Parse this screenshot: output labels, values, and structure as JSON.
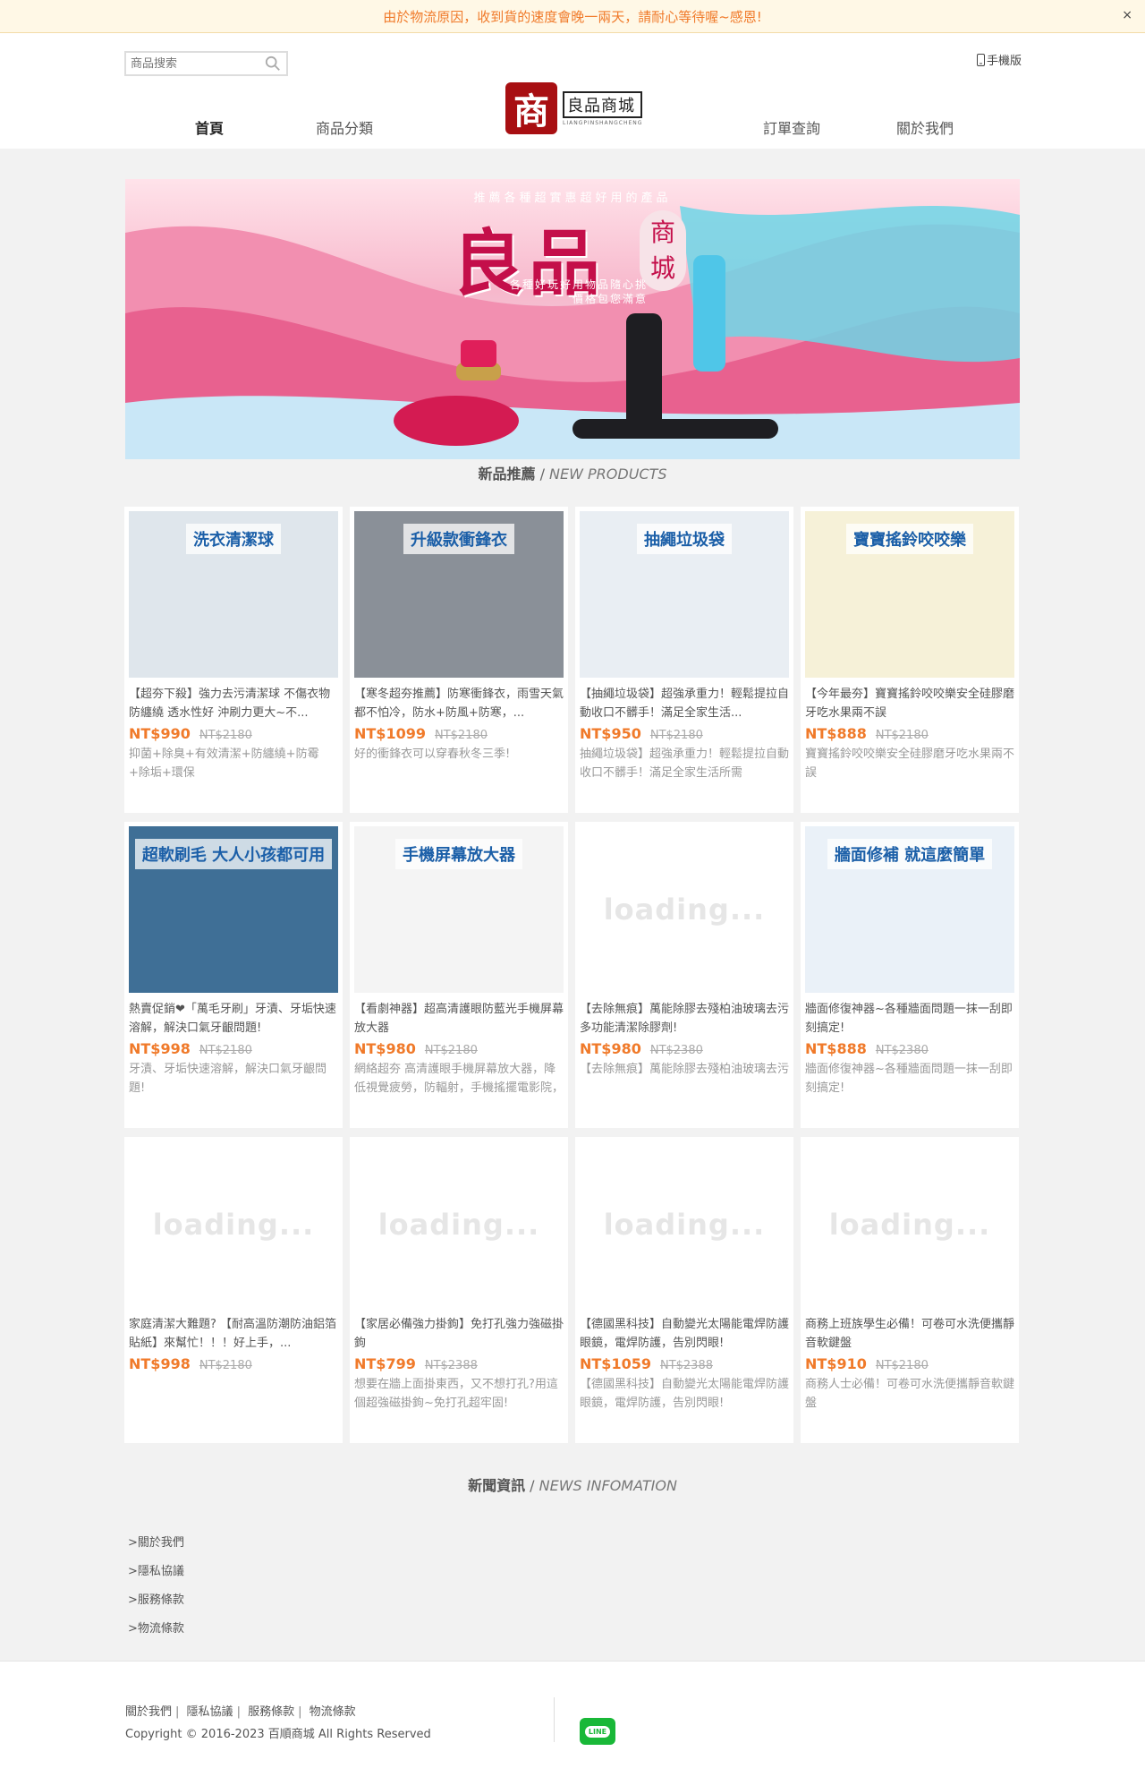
{
  "notice": {
    "text": "由於物流原因，收到貨的速度會晚一兩天，請耐心等待喔~感恩!",
    "close": "×"
  },
  "header": {
    "search_placeholder": "商品搜索",
    "mobile_label": "手機版",
    "nav": [
      "首頁",
      "商品分類",
      "訂單查詢",
      "關於我們"
    ],
    "logo_mark": "商",
    "logo_text": "良品商城",
    "logo_sub": "LIANGPINSHANGCHENG"
  },
  "banner": {
    "tagline": "推薦各種超實惠超好用的產品",
    "headline": "良品",
    "seal": [
      "商",
      "城"
    ],
    "sub_lines": [
      "各種好玩好用物品隨心挑",
      "價格包您滿意"
    ]
  },
  "sections": {
    "new_products": {
      "cn": "新品推薦",
      "sep": " / ",
      "en": "NEW PRODUCTS"
    },
    "news": {
      "cn": "新聞資訊",
      "sep": " / ",
      "en": "NEWS INFOMATION"
    }
  },
  "products": [
    {
      "image_text": "洗衣清潔球",
      "title": "【超夯下殺】強力去污清潔球 不傷衣物 防纏繞 透水性好 沖刷力更大~不...",
      "price": "NT$990",
      "old_price": "NT$2180",
      "desc": "抑菌+除臭+有效清潔+防纏繞+防霉+除垢+環保",
      "loading": false,
      "bg": "#dfe6ec"
    },
    {
      "image_text": "升級款衝鋒衣",
      "title": "【寒冬超夯推薦】防寒衝鋒衣，雨雪天氣都不怕冷，防水+防風+防寒，...",
      "price": "NT$1099",
      "old_price": "NT$2180",
      "desc": "好的衝鋒衣可以穿春秋冬三季!",
      "loading": false,
      "bg": "#8a9098"
    },
    {
      "image_text": "抽繩垃圾袋",
      "title": "【抽繩垃圾袋】超強承重力！輕鬆提拉自動收口不髒手！滿足全家生活...",
      "price": "NT$950",
      "old_price": "NT$2180",
      "desc": "抽繩垃圾袋】超強承重力！輕鬆提拉自動收口不髒手！滿足全家生活所需",
      "loading": false,
      "bg": "#e9eef3"
    },
    {
      "image_text": "寶寶搖鈴咬咬樂",
      "title": "【今年最夯】寶寶搖鈴咬咬樂安全硅膠磨牙吃水果兩不誤",
      "price": "NT$888",
      "old_price": "NT$2180",
      "desc": "寶寶搖鈴咬咬樂安全硅膠磨牙吃水果兩不誤",
      "loading": false,
      "bg": "#f6f1d8"
    },
    {
      "image_text": "超軟刷毛 大人小孩都可用",
      "title": "熱賣促銷❤「萬毛牙刷」牙漬、牙垢快速溶解，解決口氣牙齦問題!",
      "price": "NT$998",
      "old_price": "NT$2180",
      "desc": "牙漬、牙垢快速溶解，解決口氣牙齦問題!",
      "loading": false,
      "bg": "#3f6f96"
    },
    {
      "image_text": "手機屏幕放大器",
      "title": "【看劇神器】超高清護眼防藍光手機屏幕放大器",
      "price": "NT$980",
      "old_price": "NT$2180",
      "desc": "網絡超夯 高清護眼手機屏幕放大器，降低視覺疲勞，防輻射，手機搖擺電影院，輕鬆享受視覺盛宴",
      "loading": false,
      "bg": "#f4f4f4"
    },
    {
      "image_text": "loading...",
      "title": "【去除無痕】萬能除膠去殘柏油玻璃去污多功能清潔除膠劑!",
      "price": "NT$980",
      "old_price": "NT$2380",
      "desc": "【去除無痕】萬能除膠去殘柏油玻璃去污",
      "loading": true,
      "bg": "#ffffff"
    },
    {
      "image_text": "牆面修補 就這麼簡單",
      "title": "牆面修復神器~各種牆面問題一抹一刮即刻搞定!",
      "price": "NT$888",
      "old_price": "NT$2380",
      "desc": "牆面修復神器~各種牆面問題一抹一刮即刻搞定!",
      "loading": false,
      "bg": "#eaf1f8"
    },
    {
      "image_text": "loading...",
      "title": "家庭清潔大難題? 【耐高溫防潮防油鋁箔貼紙】來幫忙！！！好上手，...",
      "price": "NT$998",
      "old_price": "NT$2180",
      "desc": "",
      "loading": true,
      "bg": "#ffffff"
    },
    {
      "image_text": "loading...",
      "title": "【家居必備強力掛鉤】免打孔強力強磁掛鉤",
      "price": "NT$799",
      "old_price": "NT$2388",
      "desc": "想要在牆上面掛東西，又不想打孔?用這個超強磁掛鉤~免打孔超牢固!",
      "loading": true,
      "bg": "#ffffff"
    },
    {
      "image_text": "loading...",
      "title": "【德國黑科技】自動變光太陽能電焊防護眼鏡，電焊防護，告別閃眼!",
      "price": "NT$1059",
      "old_price": "NT$2388",
      "desc": "【德國黑科技】自動變光太陽能電焊防護眼鏡，電焊防護，告別閃眼!",
      "loading": true,
      "bg": "#ffffff"
    },
    {
      "image_text": "loading...",
      "title": "商務上班族學生必備！可卷可水洗便攜靜音軟鍵盤",
      "price": "NT$910",
      "old_price": "NT$2180",
      "desc": "商務人士必備！可卷可水洗便攜靜音軟鍵盤",
      "loading": true,
      "bg": "#ffffff"
    }
  ],
  "side_links": [
    ">關於我們",
    ">隱私協議",
    ">服務條款",
    ">物流條款"
  ],
  "footer": {
    "links": [
      "關於我們",
      "隱私協議",
      "服務條款",
      "物流條款"
    ],
    "sep": "|",
    "copyright": "Copyright © 2016-2023 百順商城 All Rights Reserved",
    "line_label": "LINE"
  },
  "colors": {
    "accent": "#f07a2a",
    "notice_bg": "#fff8e6",
    "logo_red": "#a80f12",
    "line_green": "#19b838"
  }
}
